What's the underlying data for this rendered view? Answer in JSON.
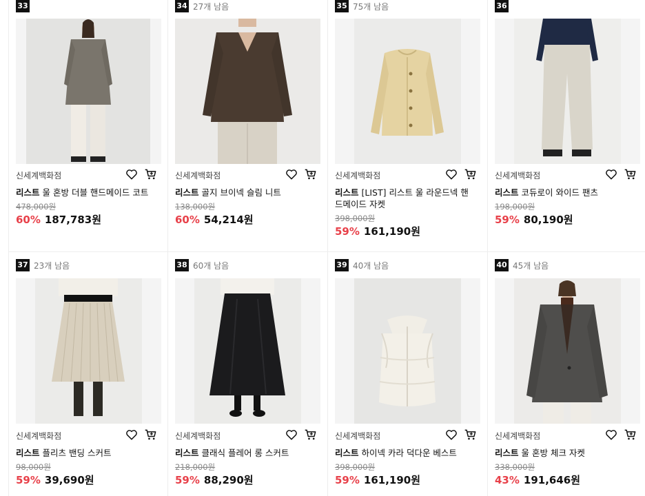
{
  "products": [
    {
      "rank": "33",
      "remaining": "",
      "store": "신세계백화점",
      "brand": "리스트",
      "name": "울 혼방 더블 핸드메이드 코트",
      "original_price": "478,000원",
      "discount": "60%",
      "price": "187,783원",
      "image": "model in taupe double-breasted coat and white pants",
      "lines": 1
    },
    {
      "rank": "34",
      "remaining": "27개 남음",
      "store": "신세계백화점",
      "brand": "리스트",
      "name": "골지 브이넥 슬림 니트",
      "original_price": "138,000원",
      "discount": "60%",
      "price": "54,214원",
      "image": "model in brown ribbed v-neck knit",
      "lines": 1
    },
    {
      "rank": "35",
      "remaining": "75개 남음",
      "store": "신세계백화점",
      "brand": "리스트",
      "name": "[LIST] 리스트 울 라운드넥 핸드메이드 자켓",
      "original_price": "398,000원",
      "discount": "59%",
      "price": "161,190원",
      "image": "beige round-neck cropped jacket",
      "lines": 2
    },
    {
      "rank": "36",
      "remaining": "",
      "store": "신세계백화점",
      "brand": "리스트",
      "name": "코듀로이 와이드 팬츠",
      "original_price": "198,000원",
      "discount": "59%",
      "price": "80,190원",
      "image": "model in ivory corduroy wide pants",
      "lines": 1
    },
    {
      "rank": "37",
      "remaining": "23개 남음",
      "store": "신세계백화점",
      "brand": "리스트",
      "name": "플리츠 밴딩 스커트",
      "original_price": "98,000원",
      "discount": "59%",
      "price": "39,690원",
      "image": "model in beige pleated skirt with boots",
      "lines": 1
    },
    {
      "rank": "38",
      "remaining": "60개 남음",
      "store": "신세계백화점",
      "brand": "리스트",
      "name": "클래식 플레어 롱 스커트",
      "original_price": "218,000원",
      "discount": "59%",
      "price": "88,290원",
      "image": "model in black flared long skirt",
      "lines": 1
    },
    {
      "rank": "39",
      "remaining": "40개 남음",
      "store": "신세계백화점",
      "brand": "리스트",
      "name": "하이넥 카라 덕다운 베스트",
      "original_price": "398,000원",
      "discount": "59%",
      "price": "161,190원",
      "image": "ivory high-neck duck down vest",
      "lines": 1
    },
    {
      "rank": "40",
      "remaining": "45개 남음",
      "store": "신세계백화점",
      "brand": "리스트",
      "name": "울 혼방 체크 자켓",
      "original_price": "338,000원",
      "discount": "43%",
      "price": "191,646원",
      "image": "model in grey wool check jacket",
      "lines": 1
    }
  ],
  "colors": {
    "discount": "#e8414a",
    "rank_bg": "#111111",
    "image_bg": "#f4f4f4"
  }
}
